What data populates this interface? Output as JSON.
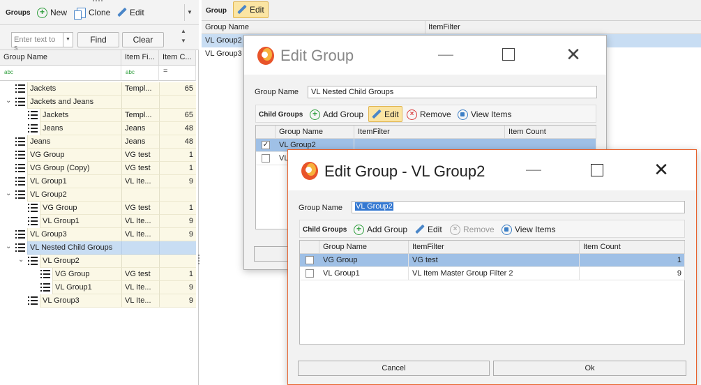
{
  "left": {
    "toolbar": {
      "title": "Groups",
      "new": "New",
      "clone": "Clone",
      "edit": "Edit"
    },
    "search": {
      "placeholder": "Enter text to s",
      "find": "Find",
      "clear": "Clear"
    },
    "columns": [
      "Group Name",
      "Item Fi...",
      "Item C..."
    ],
    "filter_icons": [
      "abc",
      "abc",
      "="
    ],
    "rows": [
      {
        "name": "Jackets",
        "filter": "Templ...",
        "count": "65"
      },
      {
        "name": "Jackets and Jeans",
        "filter": "",
        "count": ""
      },
      {
        "name": "Jackets",
        "filter": "Templ...",
        "count": "65"
      },
      {
        "name": "Jeans",
        "filter": "Jeans",
        "count": "48"
      },
      {
        "name": "Jeans",
        "filter": "Jeans",
        "count": "48"
      },
      {
        "name": "VG Group",
        "filter": "VG test",
        "count": "1"
      },
      {
        "name": "VG Group (Copy)",
        "filter": "VG test",
        "count": "1"
      },
      {
        "name": "VL Group1",
        "filter": "VL Ite...",
        "count": "9"
      },
      {
        "name": "VL Group2",
        "filter": "",
        "count": ""
      },
      {
        "name": "VG Group",
        "filter": "VG test",
        "count": "1"
      },
      {
        "name": "VL Group1",
        "filter": "VL Ite...",
        "count": "9"
      },
      {
        "name": "VL Group3",
        "filter": "VL Ite...",
        "count": "9"
      },
      {
        "name": "VL Nested Child Groups",
        "filter": "",
        "count": ""
      },
      {
        "name": "VL Group2",
        "filter": "",
        "count": ""
      },
      {
        "name": "VG Group",
        "filter": "VG test",
        "count": "1"
      },
      {
        "name": "VL Group1",
        "filter": "VL Ite...",
        "count": "9"
      },
      {
        "name": "VL Group3",
        "filter": "VL Ite...",
        "count": "9"
      }
    ]
  },
  "main": {
    "toolbar": {
      "title": "Group",
      "edit": "Edit"
    },
    "columns": [
      "Group Name",
      "ItemFilter"
    ],
    "rows": [
      "VL Group2",
      "VL Group3"
    ]
  },
  "dialog1": {
    "title": "Edit Group",
    "group_name_label": "Group Name",
    "group_name_value": "VL Nested Child Groups",
    "child_groups_label": "Child Groups",
    "add_group": "Add Group",
    "edit": "Edit",
    "remove": "Remove",
    "view_items": "View Items",
    "columns": [
      "Group Name",
      "ItemFilter",
      "Item Count"
    ],
    "rows": [
      {
        "name": "VL Group2",
        "checked": true
      },
      {
        "name": "VL",
        "checked": false
      }
    ]
  },
  "dialog2": {
    "title": "Edit Group - VL Group2",
    "group_name_label": "Group Name",
    "group_name_value": "VL Group2",
    "child_groups_label": "Child Groups",
    "add_group": "Add Group",
    "edit": "Edit",
    "remove": "Remove",
    "view_items": "View Items",
    "columns": [
      "Group Name",
      "ItemFilter",
      "Item Count"
    ],
    "rows": [
      {
        "name": "VG Group",
        "filter": "VG test",
        "count": "1"
      },
      {
        "name": "VL Group1",
        "filter": "VL Item Master Group Filter 2",
        "count": "9"
      }
    ],
    "cancel": "Cancel",
    "ok": "Ok"
  },
  "colors": {
    "accent_orange": "#e8622c",
    "selection": "#c8ddf3",
    "edit_highlight": "#fbe5a3"
  }
}
